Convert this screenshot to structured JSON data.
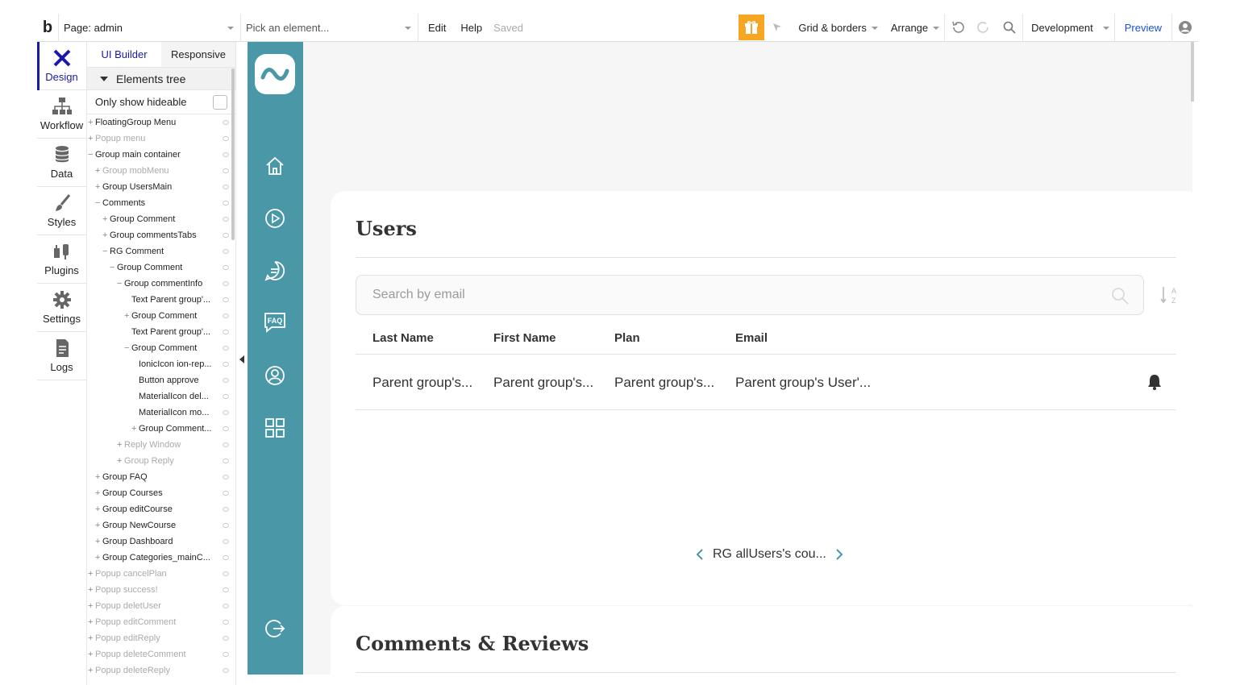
{
  "topbar": {
    "logo": "b",
    "page_select": "Page: admin",
    "element_select_placeholder": "Pick an element...",
    "edit": "Edit",
    "help": "Help",
    "saved": "Saved",
    "grid_borders": "Grid & borders",
    "arrange": "Arrange",
    "environment": "Development",
    "preview": "Preview",
    "gift_color": "#f5a623"
  },
  "leftnav": {
    "items": [
      {
        "label": "Design",
        "icon": "design-icon"
      },
      {
        "label": "Workflow",
        "icon": "workflow-icon"
      },
      {
        "label": "Data",
        "icon": "database-icon"
      },
      {
        "label": "Styles",
        "icon": "brush-icon"
      },
      {
        "label": "Plugins",
        "icon": "plug-icon"
      },
      {
        "label": "Settings",
        "icon": "gear-icon"
      },
      {
        "label": "Logs",
        "icon": "document-icon"
      }
    ]
  },
  "panel": {
    "tab_ui_builder": "UI Builder",
    "tab_responsive": "Responsive",
    "tree_header": "Elements tree",
    "filter_label": "Only show hideable",
    "tree": [
      {
        "label": "FloatingGroup Menu",
        "level": 0,
        "sign": "+",
        "dim": false
      },
      {
        "label": "Popup menu",
        "level": 0,
        "sign": "+",
        "dim": true
      },
      {
        "label": "Group main container",
        "level": 0,
        "sign": "−",
        "dim": false
      },
      {
        "label": "Group mobMenu",
        "level": 1,
        "sign": "+",
        "dim": true
      },
      {
        "label": "Group UsersMain",
        "level": 1,
        "sign": "+",
        "dim": false
      },
      {
        "label": "Comments",
        "level": 1,
        "sign": "−",
        "dim": false
      },
      {
        "label": "Group Comment",
        "level": 2,
        "sign": "+",
        "dim": false
      },
      {
        "label": "Group commentsTabs",
        "level": 2,
        "sign": "+",
        "dim": false
      },
      {
        "label": "RG Comment",
        "level": 2,
        "sign": "−",
        "dim": false
      },
      {
        "label": "Group Comment",
        "level": 3,
        "sign": "−",
        "dim": false
      },
      {
        "label": "Group commentInfo",
        "level": 4,
        "sign": "−",
        "dim": false
      },
      {
        "label": "Text Parent group'...",
        "level": 5,
        "sign": "",
        "dim": false
      },
      {
        "label": "Group Comment",
        "level": 5,
        "sign": "+",
        "dim": false
      },
      {
        "label": "Text Parent group'...",
        "level": 5,
        "sign": "",
        "dim": false
      },
      {
        "label": "Group Comment",
        "level": 5,
        "sign": "−",
        "dim": false
      },
      {
        "label": "IonicIcon ion-rep...",
        "level": 6,
        "sign": "",
        "dim": false
      },
      {
        "label": "Button approve",
        "level": 6,
        "sign": "",
        "dim": false
      },
      {
        "label": "MaterialIcon del...",
        "level": 6,
        "sign": "",
        "dim": false
      },
      {
        "label": "MaterialIcon mo...",
        "level": 6,
        "sign": "",
        "dim": false
      },
      {
        "label": "Group Comment...",
        "level": 6,
        "sign": "+",
        "dim": false
      },
      {
        "label": "Reply Window",
        "level": 4,
        "sign": "+",
        "dim": true
      },
      {
        "label": "Group Reply",
        "level": 4,
        "sign": "+",
        "dim": true
      },
      {
        "label": "Group FAQ",
        "level": 1,
        "sign": "+",
        "dim": false
      },
      {
        "label": "Group Courses",
        "level": 1,
        "sign": "+",
        "dim": false
      },
      {
        "label": "Group editCourse",
        "level": 1,
        "sign": "+",
        "dim": false
      },
      {
        "label": "Group NewCourse",
        "level": 1,
        "sign": "+",
        "dim": false
      },
      {
        "label": "Group Dashboard",
        "level": 1,
        "sign": "+",
        "dim": false
      },
      {
        "label": "Group Categories_mainC...",
        "level": 1,
        "sign": "+",
        "dim": false
      },
      {
        "label": "Popup cancelPlan",
        "level": 0,
        "sign": "+",
        "dim": true
      },
      {
        "label": "Popup success!",
        "level": 0,
        "sign": "+",
        "dim": true
      },
      {
        "label": "Popup deletUser",
        "level": 0,
        "sign": "+",
        "dim": true
      },
      {
        "label": "Popup editComment",
        "level": 0,
        "sign": "+",
        "dim": true
      },
      {
        "label": "Popup editReply",
        "level": 0,
        "sign": "+",
        "dim": true
      },
      {
        "label": "Popup deleteComment",
        "level": 0,
        "sign": "+",
        "dim": true
      },
      {
        "label": "Popup deleteReply",
        "level": 0,
        "sign": "+",
        "dim": true
      }
    ]
  },
  "canvas": {
    "accent": "#4a97a8",
    "sidebar_icons": [
      "home-icon",
      "play-icon",
      "comment-icon",
      "faq-icon",
      "user-icon",
      "grid-icon",
      "logout-icon"
    ],
    "faq_text": "FAQ",
    "users": {
      "title": "Users",
      "search_placeholder": "Search by email",
      "columns": [
        "Last Name",
        "First Name",
        "Plan",
        "Email"
      ],
      "row": [
        "Parent group's...",
        "Parent group's...",
        "Parent group's...",
        "Parent group's User'..."
      ],
      "pager_label": "RG allUsers's cou..."
    },
    "comments": {
      "title": "Comments & Reviews"
    }
  }
}
